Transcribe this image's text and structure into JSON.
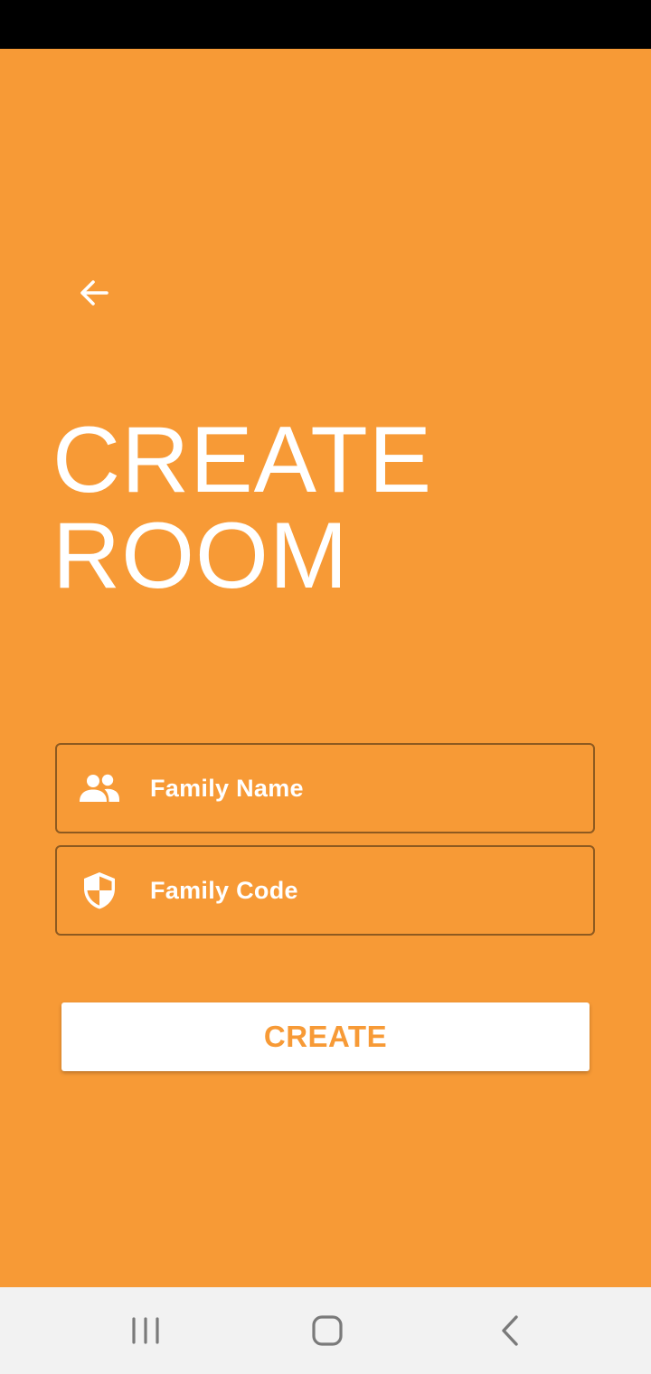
{
  "app": {
    "title": "CREATE",
    "title_line2": "ROOM"
  },
  "form": {
    "family_name": {
      "placeholder": "Family Name",
      "icon": "people-icon"
    },
    "family_code": {
      "placeholder": "Family Code",
      "icon": "shield-icon"
    },
    "submit_label": "CREATE"
  },
  "colors": {
    "background": "#F79A36",
    "field_border": "#8E5A20",
    "button_bg": "#FFFFFF",
    "button_text": "#F79A36",
    "status_bar": "#000000",
    "nav_bar": "#F2F2F2",
    "nav_icon": "#7A7A7A"
  },
  "navigation": {
    "back_icon": "arrow-left-icon",
    "system_nav": [
      "recents-icon",
      "home-icon",
      "back-chevron-icon"
    ]
  }
}
